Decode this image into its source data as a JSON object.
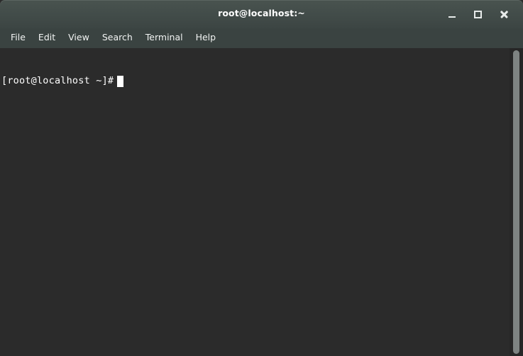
{
  "window": {
    "title": "root@localhost:~",
    "controls": {
      "minimize_label": "_",
      "maximize_label": "□",
      "close_label": "✕"
    }
  },
  "menubar": {
    "items": [
      {
        "label": "File"
      },
      {
        "label": "Edit"
      },
      {
        "label": "View"
      },
      {
        "label": "Search"
      },
      {
        "label": "Terminal"
      },
      {
        "label": "Help"
      }
    ]
  },
  "terminal": {
    "prompt": "[root@localhost ~]#",
    "command": "",
    "cursor": "block",
    "lines": []
  },
  "scrollbar": {
    "orientation": "vertical",
    "thumb_position": "full"
  },
  "colors": {
    "titlebar_top": "#49534f",
    "titlebar_bottom": "#3c4543",
    "menubar": "#3a4341",
    "terminal_background": "#2b2b2b",
    "terminal_foreground": "#ffffff",
    "scrollbar_thumb": "#7e8382",
    "scrollbar_trough": "#262626"
  }
}
